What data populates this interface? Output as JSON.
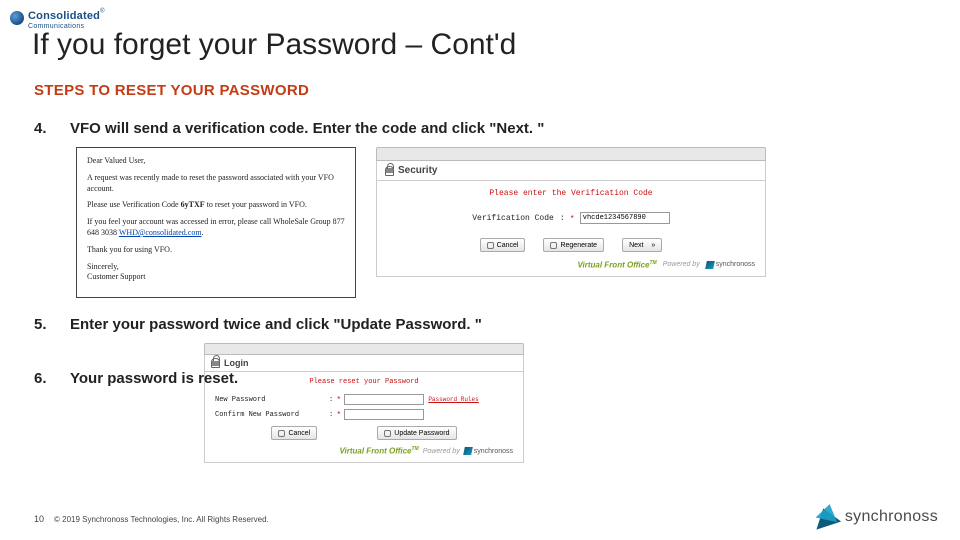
{
  "header": {
    "logo_line1": "Consolidated",
    "logo_line2": "Communications",
    "tm": "®"
  },
  "title": "If you forget your Password – Cont'd",
  "subtitle": "STEPS TO RESET YOUR PASSWORD",
  "steps": {
    "s4": {
      "num": "4.",
      "text": "VFO will send a verification code.  Enter the code and click \"Next. \""
    },
    "s5": {
      "num": "5.",
      "text": "Enter your password twice and click \"Update Password. \""
    },
    "s6": {
      "num": "6.",
      "text": "Your password is reset."
    }
  },
  "email": {
    "greeting": "Dear Valued User,",
    "line1": "A request was recently made to reset the password associated with your VFO account.",
    "line2a": "Please use Verification Code ",
    "code": "6yTXF",
    "line2b": " to reset your password in VFO.",
    "line3a": "If you feel your account was accessed in error, please call WholeSale Group 877 648 3038 ",
    "email_link": "WHD@consolidated.com",
    "line3b": ".",
    "line4": "Thank you for using VFO.",
    "sig1": "Sincerely,",
    "sig2": "Customer Support"
  },
  "security": {
    "header": "Security",
    "prompt": "Please enter the Verification Code",
    "label": "Verification Code",
    "colon": ":",
    "req": "*",
    "input_value": "vhcde1234567890",
    "btn_cancel": "Cancel",
    "btn_regen": "Regenerate",
    "btn_next": "Next",
    "btn_next_arrow": "»",
    "vfo": "Virtual Front Office",
    "vfo_tm": "TM",
    "powered": "Powered by",
    "syn": "synchronoss"
  },
  "login": {
    "header": "Login",
    "prompt": "Please reset your Password",
    "row1_label": "New Password",
    "row2_label": "Confirm New Password",
    "colon": ":",
    "req": "*",
    "rules": "Password Rules",
    "btn_cancel": "Cancel",
    "btn_update": "Update Password",
    "vfo": "Virtual Front Office",
    "vfo_tm": "TM",
    "powered": "Powered by",
    "syn": "synchronoss"
  },
  "footer": {
    "page": "10",
    "copyright": "© 2019 Synchronoss Technologies, Inc. All Rights Reserved.",
    "brand": "synchronoss"
  }
}
